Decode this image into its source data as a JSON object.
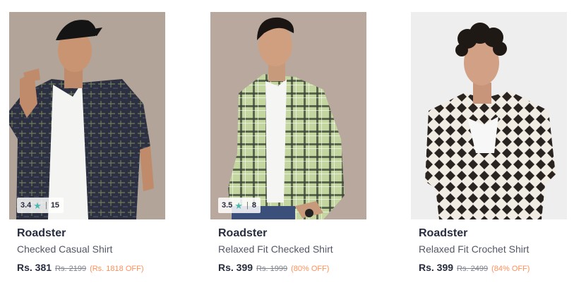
{
  "products": [
    {
      "image_alt": "Checked Casual Shirt",
      "rating": "3.4",
      "rating_count": "15",
      "brand": "Roadster",
      "title": "Checked Casual Shirt",
      "price": "Rs. 381",
      "mrp": "Rs. 2199",
      "discount": "(Rs. 1818 OFF)"
    },
    {
      "image_alt": "Relaxed Fit Checked Shirt",
      "rating": "3.5",
      "rating_count": "8",
      "brand": "Roadster",
      "title": "Relaxed Fit Checked Shirt",
      "price": "Rs. 399",
      "mrp": "Rs. 1999",
      "discount": "(80% OFF)"
    },
    {
      "image_alt": "Relaxed Fit Crochet Shirt",
      "brand": "Roadster",
      "title": "Relaxed Fit Crochet Shirt",
      "price": "Rs. 399",
      "mrp": "Rs. 2499",
      "discount": "(84% OFF)"
    }
  ],
  "colors": {
    "star": "#4db8b0",
    "discount": "#ff905a",
    "brand": "#282c3f"
  },
  "icons": {
    "rating": "star-icon"
  }
}
